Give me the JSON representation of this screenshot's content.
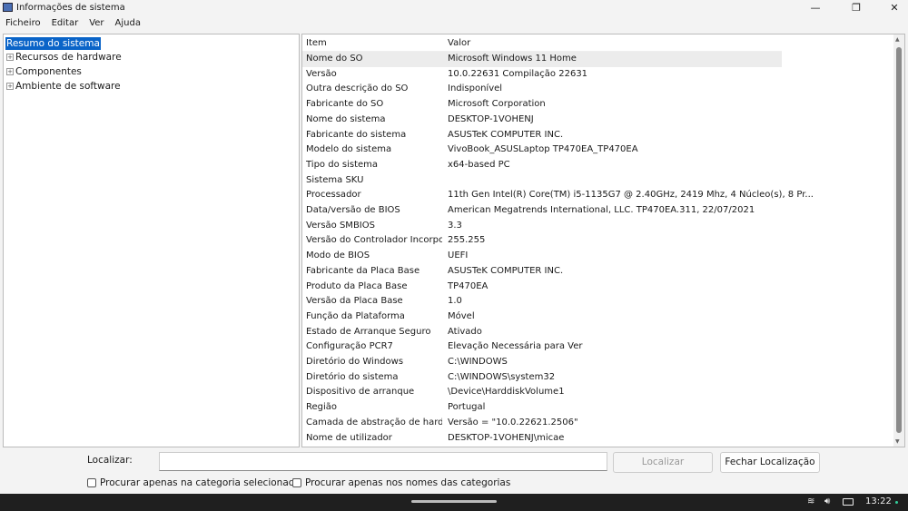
{
  "window": {
    "title": "Informações de sistema",
    "minimize": "—",
    "maximize": "❐",
    "close": "✕"
  },
  "menu": [
    "Ficheiro",
    "Editar",
    "Ver",
    "Ajuda"
  ],
  "tree": [
    {
      "label": "Resumo do sistema",
      "selected": true,
      "expandable": false
    },
    {
      "label": "Recursos de hardware",
      "expandable": true
    },
    {
      "label": "Componentes",
      "expandable": true
    },
    {
      "label": "Ambiente de software",
      "expandable": true
    }
  ],
  "table": {
    "headers": [
      "Item",
      "Valor"
    ],
    "rows": [
      [
        "Nome do SO",
        "Microsoft Windows 11 Home"
      ],
      [
        "Versão",
        "10.0.22631 Compilação 22631"
      ],
      [
        "Outra descrição do SO",
        "Indisponível"
      ],
      [
        "Fabricante do SO",
        "Microsoft Corporation"
      ],
      [
        "Nome do sistema",
        "DESKTOP-1VOHENJ"
      ],
      [
        "Fabricante do sistema",
        "ASUSTeK COMPUTER INC."
      ],
      [
        "Modelo do sistema",
        "VivoBook_ASUSLaptop TP470EA_TP470EA"
      ],
      [
        "Tipo do sistema",
        "x64-based PC"
      ],
      [
        "Sistema SKU",
        ""
      ],
      [
        "Processador",
        "11th Gen Intel(R) Core(TM) i5-1135G7 @ 2.40GHz, 2419 Mhz, 4 Núcleo(s), 8 Pr..."
      ],
      [
        "Data/versão de BIOS",
        "American Megatrends International, LLC. TP470EA.311, 22/07/2021"
      ],
      [
        "Versão SMBIOS",
        "3.3"
      ],
      [
        "Versão do Controlador Incorpor...",
        "255.255"
      ],
      [
        "Modo de BIOS",
        "UEFI"
      ],
      [
        "Fabricante da Placa Base",
        "ASUSTeK COMPUTER INC."
      ],
      [
        "Produto da Placa Base",
        "TP470EA"
      ],
      [
        "Versão da Placa Base",
        "1.0"
      ],
      [
        "Função da Plataforma",
        "Móvel"
      ],
      [
        "Estado de Arranque Seguro",
        "Ativado"
      ],
      [
        "Configuração PCR7",
        "Elevação Necessária para Ver"
      ],
      [
        "Diretório do Windows",
        "C:\\WINDOWS"
      ],
      [
        "Diretório do sistema",
        "C:\\WINDOWS\\system32"
      ],
      [
        "Dispositivo de arranque",
        "\\Device\\HarddiskVolume1"
      ],
      [
        "Região",
        "Portugal"
      ],
      [
        "Camada de abstração de hardw...",
        "Versão = \"10.0.22621.2506\""
      ],
      [
        "Nome de utilizador",
        "DESKTOP-1VOHENJ\\micae"
      ]
    ]
  },
  "find": {
    "label": "Localizar:",
    "value": "",
    "find_button": "Localizar",
    "close_button": "Fechar Localização",
    "check1": "Procurar apenas na categoria selecionada",
    "check2": "Procurar apenas nos nomes das categorias"
  },
  "taskbar": {
    "time": "13:22",
    "icons": [
      "wifi-icon",
      "volume-icon",
      "battery-icon"
    ]
  }
}
